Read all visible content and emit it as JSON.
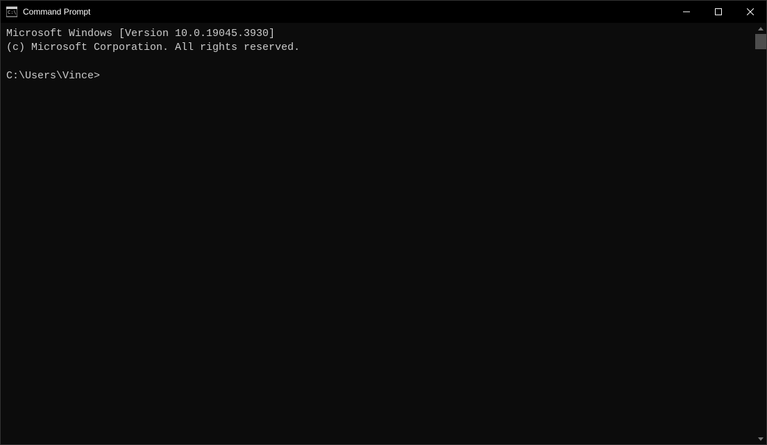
{
  "titlebar": {
    "title": "Command Prompt",
    "icon_name": "cmd-icon"
  },
  "terminal": {
    "line1": "Microsoft Windows [Version 10.0.19045.3930]",
    "line2": "(c) Microsoft Corporation. All rights reserved.",
    "blank": "",
    "prompt": "C:\\Users\\Vince>",
    "input_value": ""
  }
}
